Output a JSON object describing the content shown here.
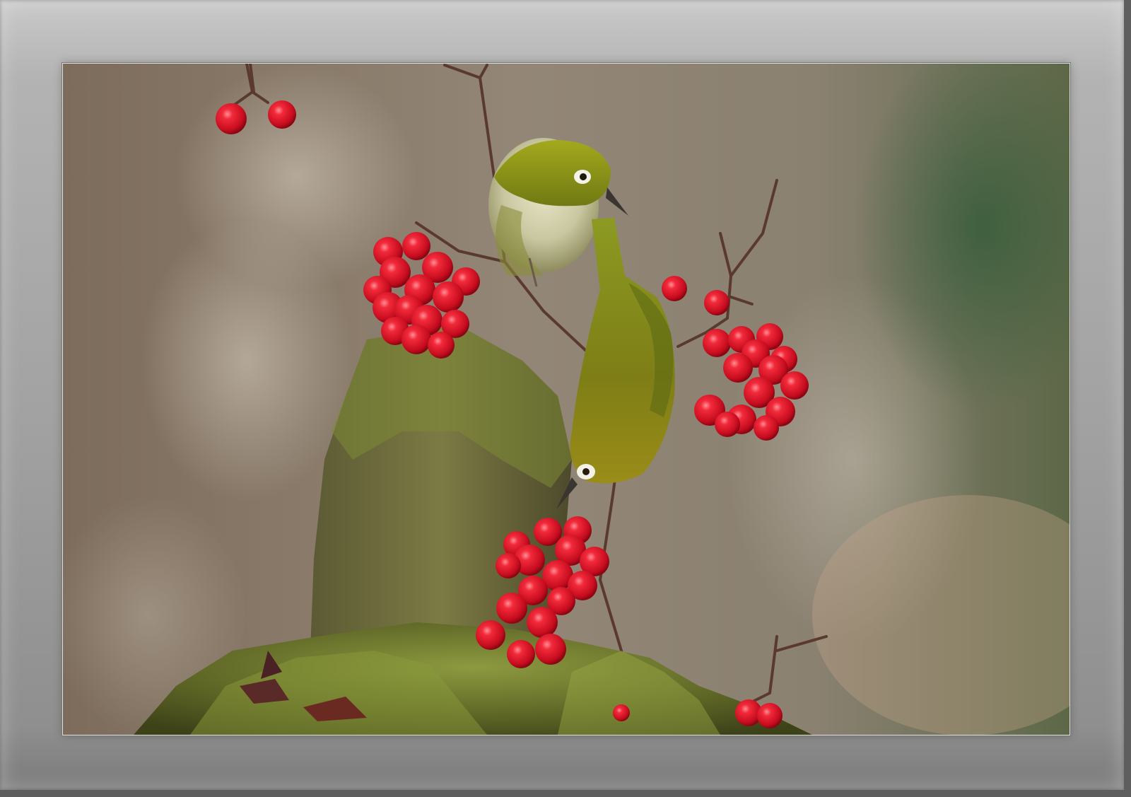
{
  "image": {
    "subject": "two-white-eye-birds-on-red-berry-branch",
    "colors": {
      "frame": "#a8a8a8",
      "bird_green": "#8e9a1a",
      "berry_red": "#e0122a",
      "moss": "#6f7a28"
    }
  }
}
